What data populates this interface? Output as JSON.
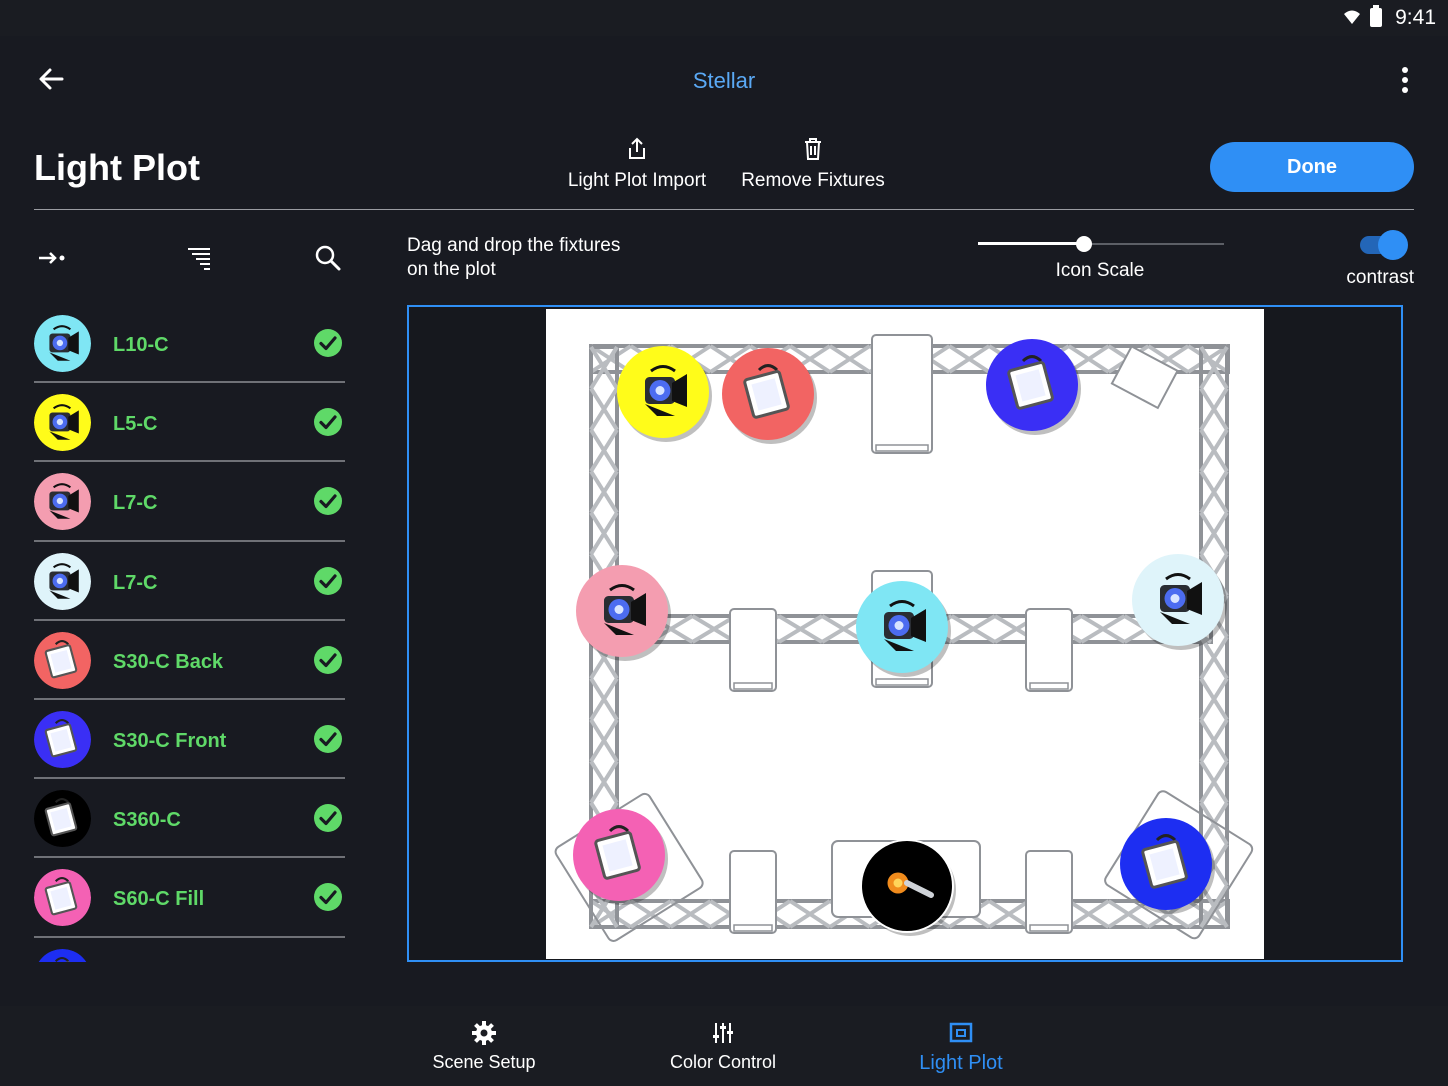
{
  "status_bar": {
    "time": "9:41"
  },
  "app_bar": {
    "title": "Stellar"
  },
  "header": {
    "page_title": "Light Plot",
    "import_label": "Light Plot Import",
    "remove_label": "Remove Fixtures",
    "done_label": "Done"
  },
  "plot_controls": {
    "hint": "Dag and drop the fixtures on the plot",
    "icon_scale_label": "Icon Scale",
    "icon_scale_value": 0.43,
    "contrast_label": "contrast",
    "contrast_on": true
  },
  "fixtures": [
    {
      "name": "L10-C",
      "color": "#7fe6f4",
      "icon": "fresnel-light-icon",
      "placed": true
    },
    {
      "name": "L5-C",
      "color": "#fffc1a",
      "icon": "fresnel-light-icon",
      "placed": true
    },
    {
      "name": "L7-C",
      "color": "#f49db0",
      "icon": "fresnel-light-icon",
      "placed": true
    },
    {
      "name": "L7-C",
      "color": "#dff4fa",
      "icon": "fresnel-light-icon",
      "placed": true
    },
    {
      "name": "S30-C Back",
      "color": "#f26463",
      "icon": "soft-panel-light-icon",
      "placed": true
    },
    {
      "name": "S30-C Front",
      "color": "#3a2ff5",
      "icon": "soft-panel-light-icon",
      "placed": true
    },
    {
      "name": "S360-C",
      "color": "#000000",
      "icon": "soft-panel-light-icon",
      "placed": true
    },
    {
      "name": "S60-C Fill",
      "color": "#f461b4",
      "icon": "soft-panel-light-icon",
      "placed": true
    },
    {
      "name": "",
      "color": "#1d2ef2",
      "icon": "soft-panel-light-icon",
      "placed": true
    }
  ],
  "plot_fixtures": [
    {
      "color": "#fffc1a",
      "type": "fresnel"
    },
    {
      "color": "#f26463",
      "type": "panel"
    },
    {
      "color": "#3a2ff5",
      "type": "panel"
    },
    {
      "color": "#f49db0",
      "type": "fresnel"
    },
    {
      "color": "#7fe6f4",
      "type": "fresnel"
    },
    {
      "color": "#dff4fa",
      "type": "fresnel"
    },
    {
      "color": "#f461b4",
      "type": "panel"
    },
    {
      "color": "#000000",
      "type": "spot"
    },
    {
      "color": "#1d2ef2",
      "type": "panel"
    }
  ],
  "bottom_nav": {
    "scene_setup": "Scene Setup",
    "color_control": "Color Control",
    "light_plot": "Light Plot"
  },
  "colors": {
    "accent": "#2f8ff5",
    "ok_green": "#5fd968",
    "background": "#181a21"
  }
}
